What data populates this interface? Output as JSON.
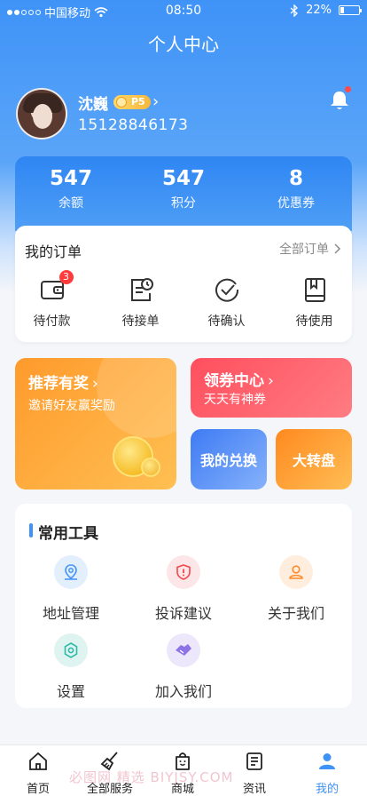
{
  "status_bar": {
    "carrier": "中国移动",
    "time": "08:50",
    "battery": "22%"
  },
  "header": {
    "title": "个人中心"
  },
  "profile": {
    "name": "沈巍",
    "level": "P5",
    "phone": "15128846173"
  },
  "stats": [
    {
      "value": "547",
      "label": "余额"
    },
    {
      "value": "547",
      "label": "积分"
    },
    {
      "value": "8",
      "label": "优惠券"
    }
  ],
  "orders": {
    "title": "我的订单",
    "all_label": "全部订单",
    "items": [
      {
        "label": "待付款",
        "icon": "wallet-icon",
        "badge": "3"
      },
      {
        "label": "待接单",
        "icon": "clock-document-icon"
      },
      {
        "label": "待确认",
        "icon": "check-circle-icon"
      },
      {
        "label": "待使用",
        "icon": "bookmark-book-icon"
      }
    ]
  },
  "promos": {
    "referral": {
      "title": "推荐有奖",
      "subtitle": "邀请好友赢奖励"
    },
    "coupon": {
      "title": "领券中心",
      "subtitle": "天天有神券"
    },
    "redeem": {
      "title": "我的兑换"
    },
    "wheel": {
      "title": "大转盘"
    }
  },
  "tools": {
    "title": "常用工具",
    "items": [
      {
        "label": "地址管理",
        "icon": "location-icon",
        "color": "#3f93f7"
      },
      {
        "label": "投诉建议",
        "icon": "shield-alert-icon",
        "color": "#f0474e"
      },
      {
        "label": "关于我们",
        "icon": "user-icon",
        "color": "#ff8a2a"
      },
      {
        "label": "设置",
        "icon": "gear-icon",
        "color": "#2cb9a8"
      },
      {
        "label": "加入我们",
        "icon": "handshake-icon",
        "color": "#8d72e8"
      }
    ]
  },
  "tabbar": [
    {
      "label": "首页",
      "icon": "home-icon"
    },
    {
      "label": "全部服务",
      "icon": "broom-icon"
    },
    {
      "label": "商城",
      "icon": "shopping-bag-icon"
    },
    {
      "label": "资讯",
      "icon": "news-icon"
    },
    {
      "label": "我的",
      "icon": "profile-icon",
      "active": true
    }
  ],
  "watermark": "必图网 精选 BIYJSY.COM",
  "colors": {
    "primary": "#3f93f7",
    "orange": "#ff9a2c",
    "red": "#ff4f5e"
  }
}
